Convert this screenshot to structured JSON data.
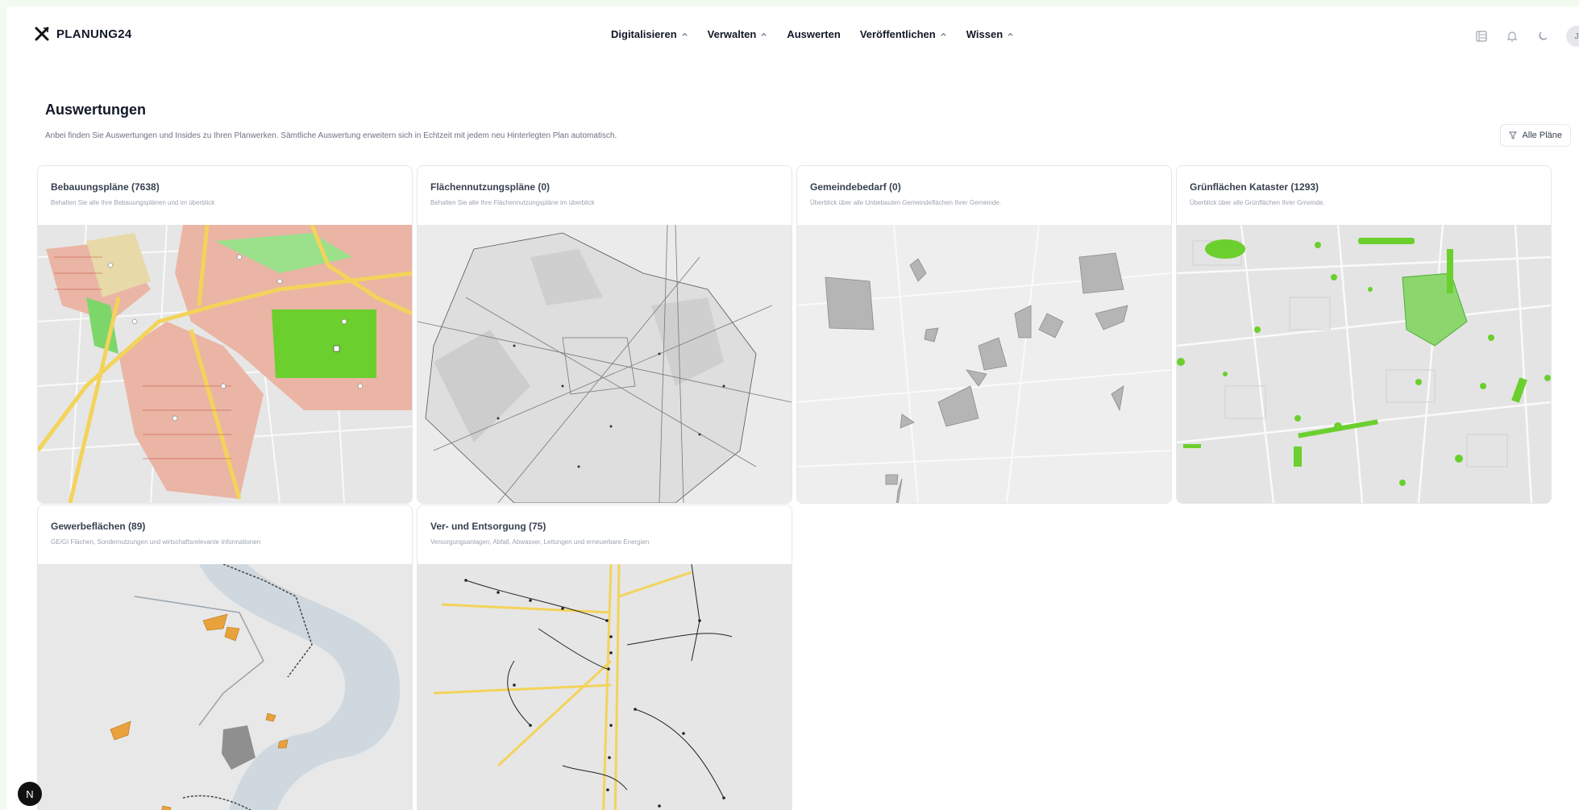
{
  "app": {
    "brand": "PLANUNG24"
  },
  "nav": [
    {
      "label": "Digitalisieren",
      "has_menu": true
    },
    {
      "label": "Verwalten",
      "has_menu": true
    },
    {
      "label": "Auswerten",
      "has_menu": false
    },
    {
      "label": "Veröffentlichen",
      "has_menu": true
    },
    {
      "label": "Wissen",
      "has_menu": true
    }
  ],
  "header_icons": [
    "table-icon",
    "bell-icon",
    "theme-icon"
  ],
  "user": {
    "initial": "J"
  },
  "page": {
    "title": "Auswertungen",
    "description": "Anbei finden Sie Auswertungen und Insides zu Ihren Planwerken. Sämtliche Auswertung erweitern sich in Echtzeit mit jedem neu Hinterlegten Plan automatisch.",
    "filter_label": "Alle Pläne"
  },
  "cards": [
    {
      "title": "Bebauungspläne (7638)",
      "subtitle": "Behalten Sie alle Ihre Bebauungsplänen und im überblick",
      "map": "bebauung"
    },
    {
      "title": "Flächennutzungspläne (0)",
      "subtitle": "Behalten Sie alle Ihre Flächennutzungspläne im überblick",
      "map": "flaechen"
    },
    {
      "title": "Gemeindebedarf (0)",
      "subtitle": "Überblick über alle Unbebauten Gemeindeflächen Ihrer Gemeinde.",
      "map": "gemeinde"
    },
    {
      "title": "Grünflächen Kataster (1293)",
      "subtitle": "Überblick über alle Grünflächen Ihrer Gmeinde.",
      "map": "gruen"
    },
    {
      "title": "Gewerbeflächen (89)",
      "subtitle": "GE/GI Flächen, Sondernutzungen und wirtschaftsrelevante Informationen",
      "map": "gewerbe"
    },
    {
      "title": "Ver- und Entsorgung (75)",
      "subtitle": "Versorgungsanlagen, Abfall, Abwasser, Leitungen und erneuerbare Energien",
      "map": "versorgung"
    }
  ],
  "badge": {
    "label": "N"
  },
  "colors": {
    "background": "#f1fbef",
    "map_base": "#e9e9e9",
    "green": "#6bcf2e",
    "salmon": "#eab5a5",
    "yellow": "#f3d35a",
    "orange": "#e9a23b"
  }
}
